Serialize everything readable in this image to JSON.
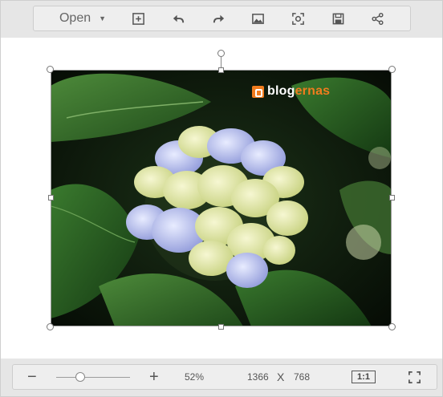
{
  "toolbar": {
    "open_label": "Open",
    "icons": [
      "add-image-icon",
      "undo-icon",
      "redo-icon",
      "image-icon",
      "screenshot-icon",
      "save-icon",
      "share-icon"
    ]
  },
  "canvas": {
    "image": {
      "description_icon": "hydrangea-photo",
      "watermark_prefix": "blog",
      "watermark_suffix": "ernas",
      "watermark_color": "#f07c1e"
    }
  },
  "statusbar": {
    "zoom_out_label": "−",
    "zoom_in_label": "+",
    "zoom_level_fraction": 0.33,
    "zoom_percent": "52%",
    "width": "1366",
    "separator": "X",
    "height": "768",
    "ratio_label": "1:1"
  }
}
